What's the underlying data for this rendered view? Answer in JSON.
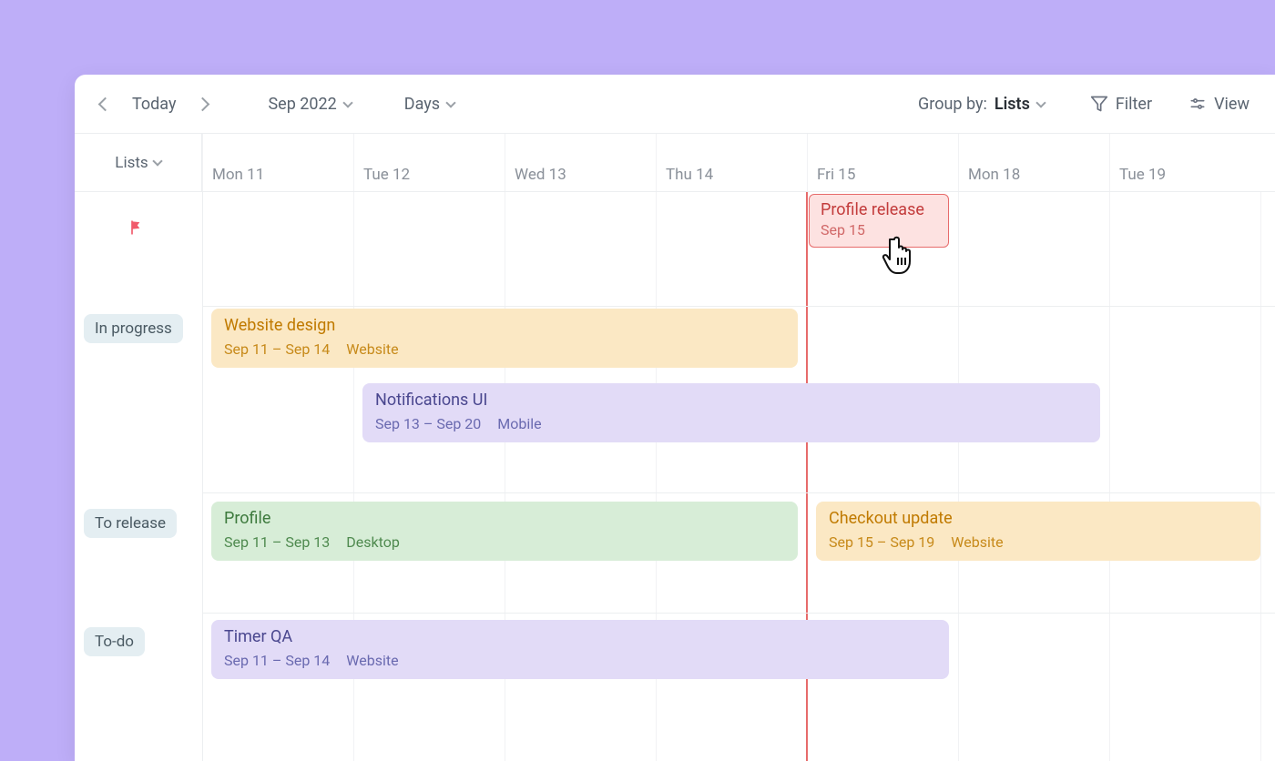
{
  "toolbar": {
    "today_label": "Today",
    "month_label": "Sep 2022",
    "granularity_label": "Days",
    "group_by_prefix": "Group by: ",
    "group_by_value": "Lists",
    "filter_label": "Filter",
    "view_label": "View"
  },
  "sidebar": {
    "header_label": "Lists"
  },
  "days": [
    {
      "label": "Mon 11"
    },
    {
      "label": "Tue 12"
    },
    {
      "label": "Wed 13"
    },
    {
      "label": "Thu 14"
    },
    {
      "label": "Fri 15"
    },
    {
      "label": "Mon 18"
    },
    {
      "label": "Tue 19"
    }
  ],
  "groups": {
    "milestone_row": {},
    "in_progress": {
      "label": "In progress"
    },
    "to_release": {
      "label": "To release"
    },
    "to_do": {
      "label": "To-do"
    }
  },
  "tasks": {
    "profile_release": {
      "title": "Profile release",
      "date": "Sep 15"
    },
    "website_design": {
      "title": "Website design",
      "range": "Sep 11 –  Sep 14",
      "tag": "Website"
    },
    "notifications_ui": {
      "title": "Notifications UI",
      "range": "Sep 13 –  Sep 20",
      "tag": "Mobile"
    },
    "profile": {
      "title": "Profile",
      "range": "Sep 11 –  Sep 13",
      "tag": "Desktop"
    },
    "checkout_update": {
      "title": "Checkout update",
      "range": "Sep 15 –  Sep 19",
      "tag": "Website"
    },
    "timer_qa": {
      "title": "Timer QA",
      "range": "Sep 11 –  Sep 14",
      "tag": "Website"
    }
  }
}
